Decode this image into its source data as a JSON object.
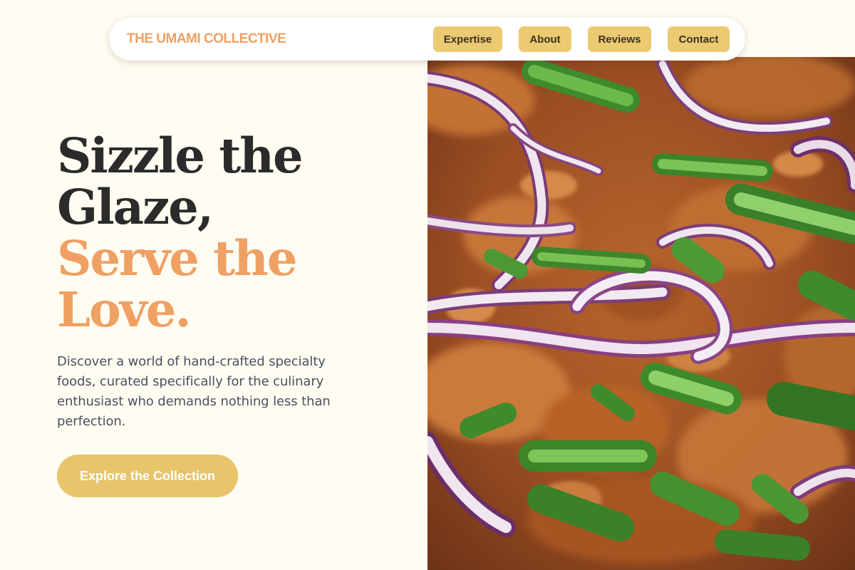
{
  "nav": {
    "brand": "THE UMAMI COLLECTIVE",
    "items": [
      {
        "label": "Expertise"
      },
      {
        "label": "About"
      },
      {
        "label": "Reviews"
      },
      {
        "label": "Contact"
      }
    ]
  },
  "hero": {
    "headline_line1": "Sizzle the",
    "headline_line2": "Glaze,",
    "headline_line3": "Serve the",
    "headline_line4": "Love.",
    "description": "Discover a world of hand-crafted specialty foods, curated specifically for the culinary enthusiast who demands nothing less than perfection.",
    "cta_label": "Explore the Collection",
    "image_subject": "close-up of glazed food topped with sliced red onion and green onion"
  },
  "colors": {
    "background": "#fffcf1",
    "brand_accent": "#efa063",
    "nav_button": "#ecca72",
    "cta_button": "#e8c46b",
    "heading_dark": "#2b2b2b",
    "body_text": "#4b5160"
  }
}
